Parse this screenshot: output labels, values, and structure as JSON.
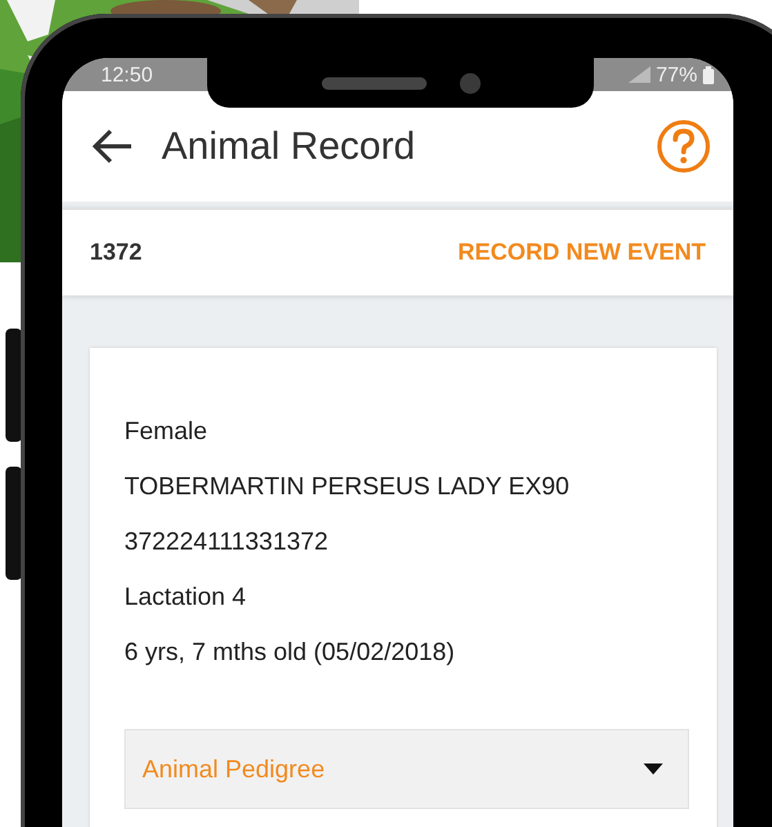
{
  "status_bar": {
    "time": "12:50",
    "battery": "77%"
  },
  "header": {
    "title": "Animal Record"
  },
  "record_bar": {
    "tag": "1372",
    "action": "RECORD NEW EVENT"
  },
  "details": [
    "Female",
    "TOBERMARTIN PERSEUS LADY EX90",
    "372224111331372",
    "Lactation 4",
    "6 yrs, 7 mths old (05/02/2018)"
  ],
  "dropdown": {
    "label": "Animal Pedigree",
    "expanded": false
  }
}
